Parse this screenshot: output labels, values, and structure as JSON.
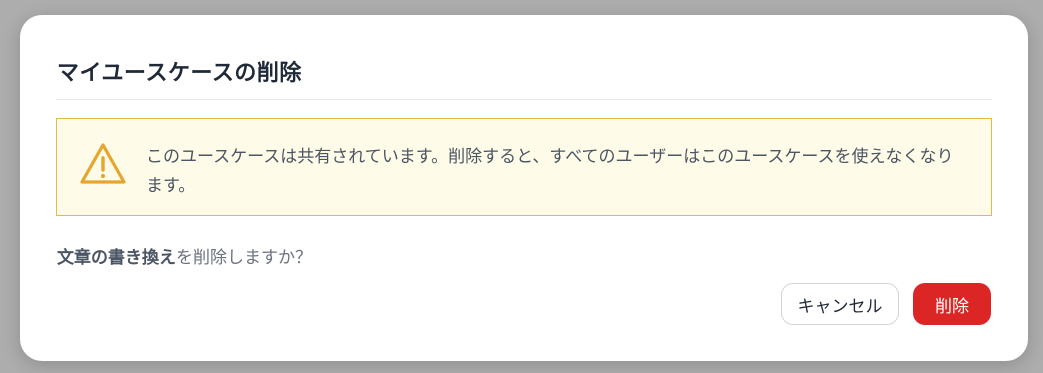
{
  "dialog": {
    "title": "マイユースケースの削除",
    "warning": {
      "icon": "warning-triangle-icon",
      "message": "このユースケースは共有されています。削除すると、すべてのユーザーはこのユースケースを使えなくなります。"
    },
    "question": {
      "target_name": "文章の書き換え",
      "suffix": "を削除しますか？"
    },
    "buttons": {
      "cancel_label": "キャンセル",
      "delete_label": "削除"
    }
  },
  "colors": {
    "overlay": "#adadad",
    "warning_bg": "#fefce8",
    "warning_border": "#e5b84a",
    "warning_icon": "#e5a52e",
    "delete_button": "#dc2626"
  }
}
